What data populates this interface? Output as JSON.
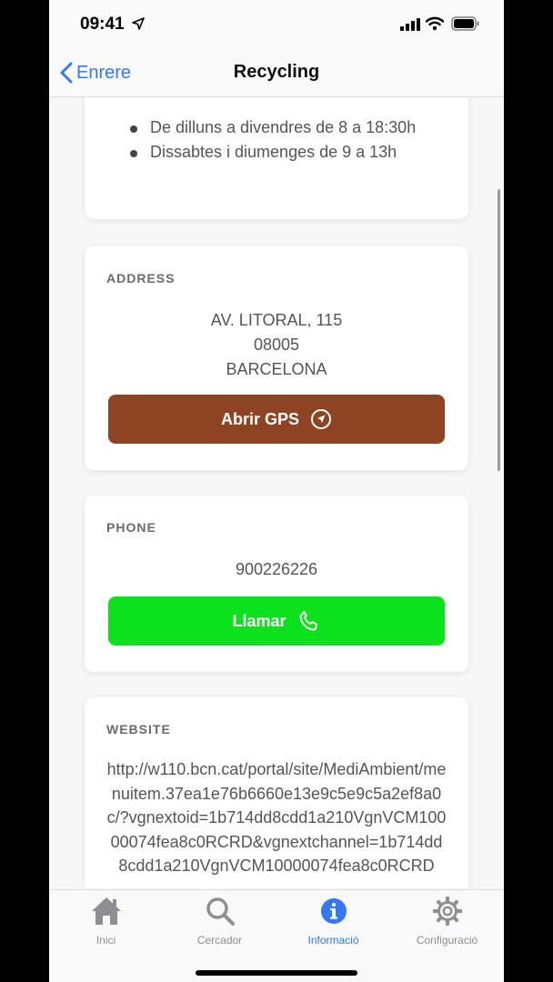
{
  "status_bar": {
    "time": "09:41"
  },
  "nav": {
    "back_label": "Enrere",
    "title": "Recycling"
  },
  "hours": {
    "items": [
      "De dilluns a divendres de 8 a 18:30h",
      "Dissabtes i diumenges de 9 a 13h"
    ]
  },
  "address": {
    "label": "ADDRESS",
    "line1": "AV. LITORAL, 115",
    "line2": "08005",
    "line3": "BARCELONA",
    "button_label": "Abrir GPS",
    "button_color": "#8e4423"
  },
  "phone": {
    "label": "PHONE",
    "number": "900226226",
    "button_label": "Llamar",
    "button_color": "#0be21c"
  },
  "website": {
    "label": "WEBSITE",
    "url": "http://w110.bcn.cat/portal/site/MediAmbient/menuitem.37ea1e76b6660e13e9c5e9c5a2ef8a0c/?vgnextoid=1b714dd8cdd1a210VgnVCM10000074fea8c0RCRD&vgnextchannel=1b714dd8cdd1a210VgnVCM10000074fea8c0RCRD"
  },
  "tabs": [
    {
      "label": "Inici",
      "icon": "home-icon",
      "active": false
    },
    {
      "label": "Cercador",
      "icon": "search-icon",
      "active": false
    },
    {
      "label": "Informació",
      "icon": "info-icon",
      "active": true
    },
    {
      "label": "Configuració",
      "icon": "gear-icon",
      "active": false
    }
  ],
  "colors": {
    "accent": "#3478f6",
    "inactive": "#8e8e93"
  }
}
